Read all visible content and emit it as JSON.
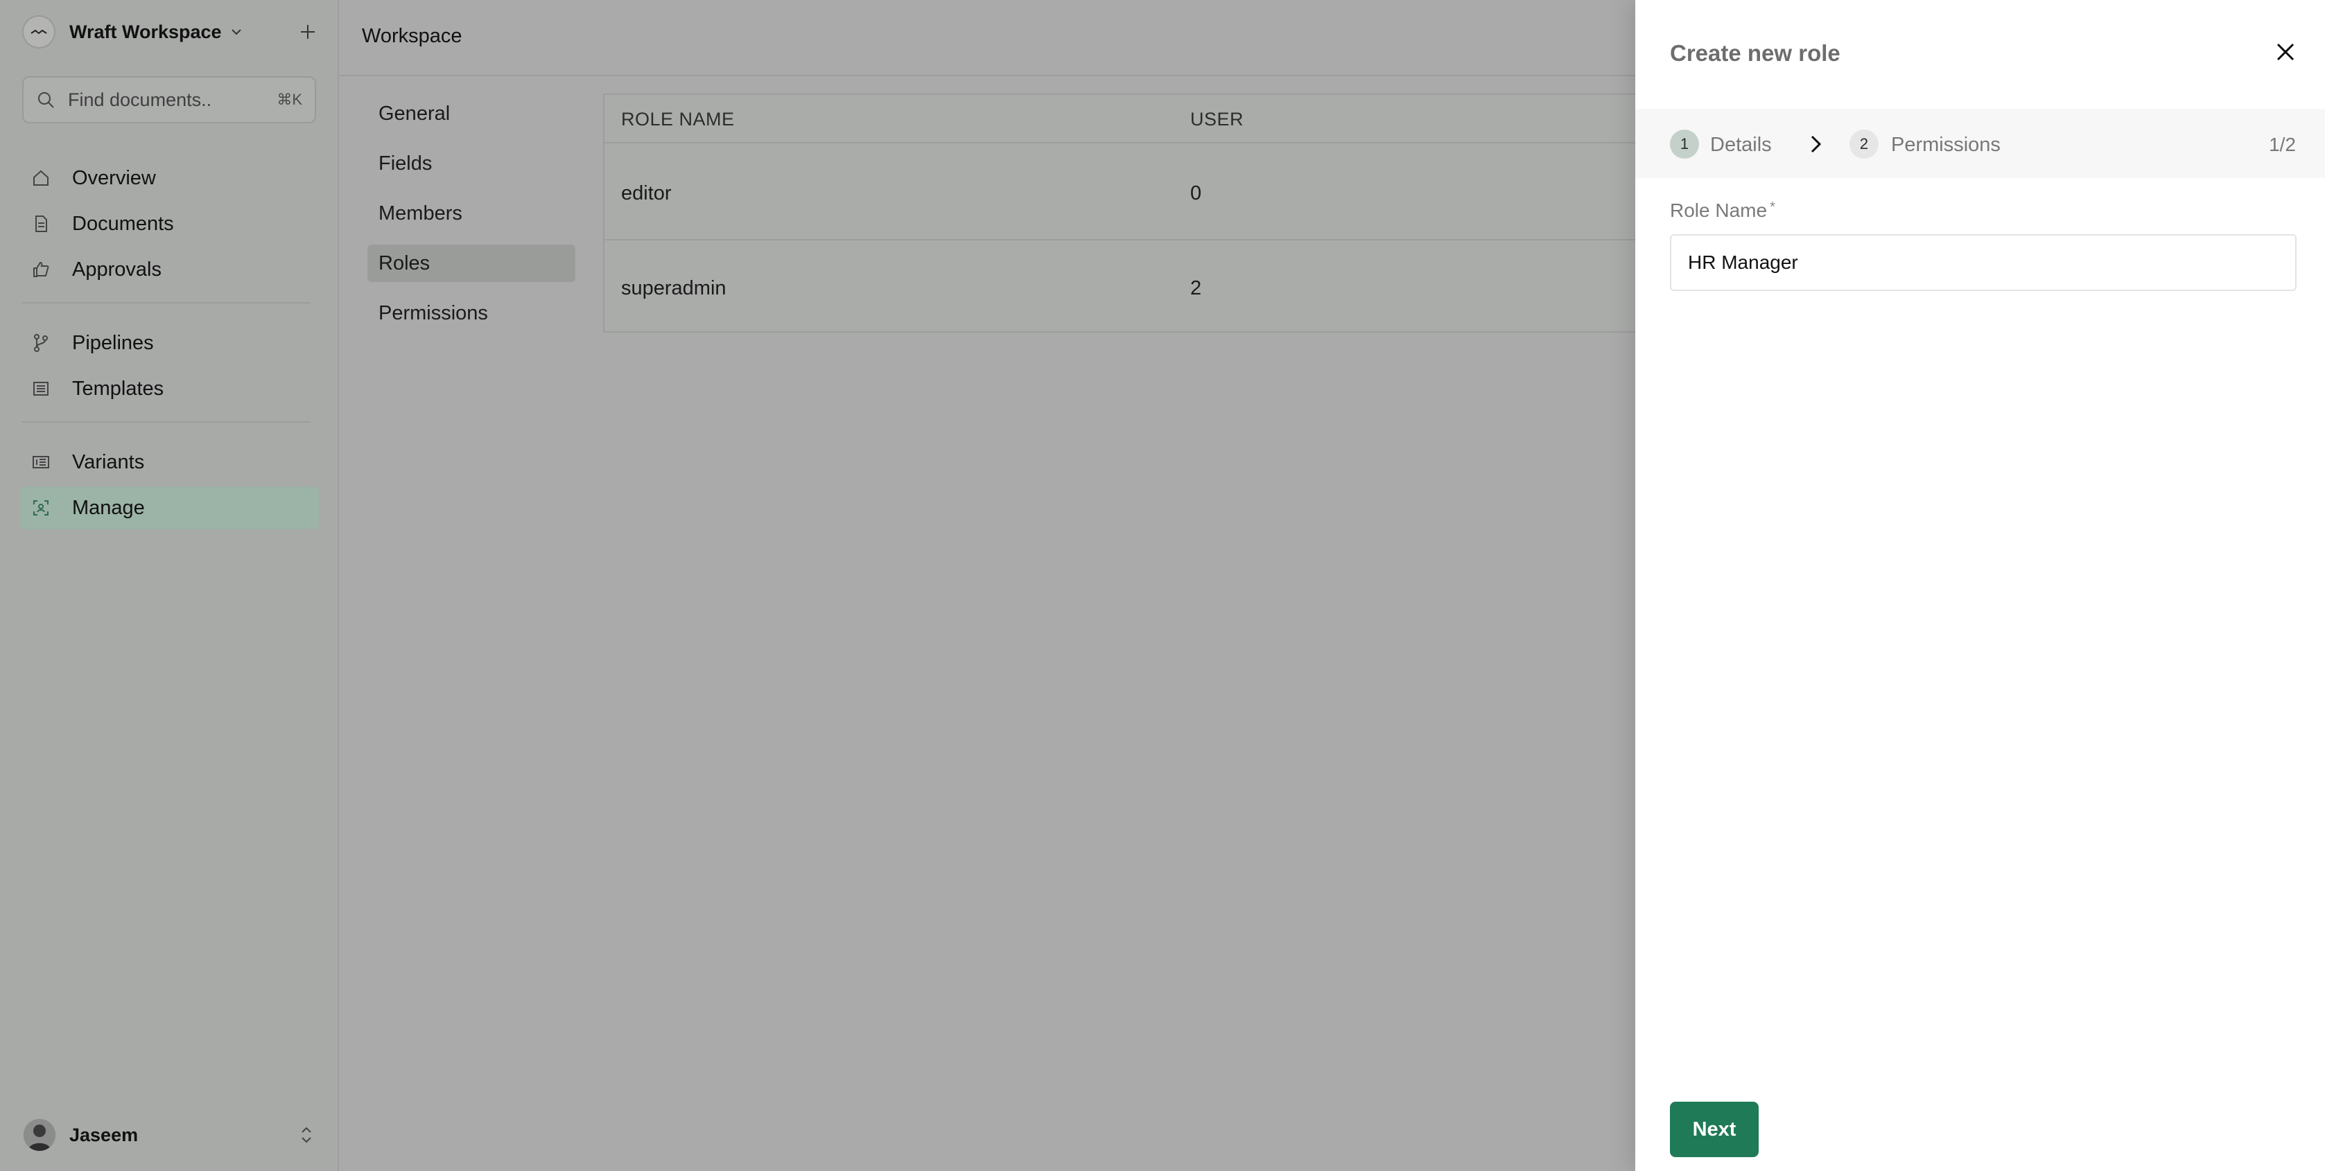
{
  "workspace": {
    "name": "Wraft Workspace"
  },
  "search": {
    "placeholder": "Find documents..",
    "shortcut": "⌘K"
  },
  "nav": {
    "primary": [
      {
        "label": "Overview",
        "icon": "home-icon"
      },
      {
        "label": "Documents",
        "icon": "document-icon"
      },
      {
        "label": "Approvals",
        "icon": "thumbs-up-icon"
      }
    ],
    "secondary": [
      {
        "label": "Pipelines",
        "icon": "git-branch-icon"
      },
      {
        "label": "Templates",
        "icon": "template-icon"
      }
    ],
    "tertiary": [
      {
        "label": "Variants",
        "icon": "variants-icon"
      },
      {
        "label": "Manage",
        "icon": "manage-icon",
        "active": true
      }
    ]
  },
  "user": {
    "name": "Jaseem"
  },
  "page": {
    "title": "Workspace"
  },
  "subnav": {
    "items": [
      "General",
      "Fields",
      "Members",
      "Roles",
      "Permissions"
    ],
    "active": "Roles"
  },
  "roles_table": {
    "columns": [
      "ROLE NAME",
      "USER"
    ],
    "rows": [
      {
        "role": "editor",
        "users": "0"
      },
      {
        "role": "superadmin",
        "users": "2"
      }
    ]
  },
  "drawer": {
    "title": "Create new role",
    "steps": [
      {
        "number": "1",
        "label": "Details",
        "state": "current"
      },
      {
        "number": "2",
        "label": "Permissions",
        "state": "upcoming"
      }
    ],
    "step_count": "1/2",
    "field": {
      "label": "Role Name",
      "required_mark": "*",
      "value": "HR Manager"
    },
    "next_label": "Next"
  },
  "colors": {
    "accent": "#1f7a57",
    "active_nav": "#9cb3a7",
    "overlay": "#a9aaa9"
  }
}
